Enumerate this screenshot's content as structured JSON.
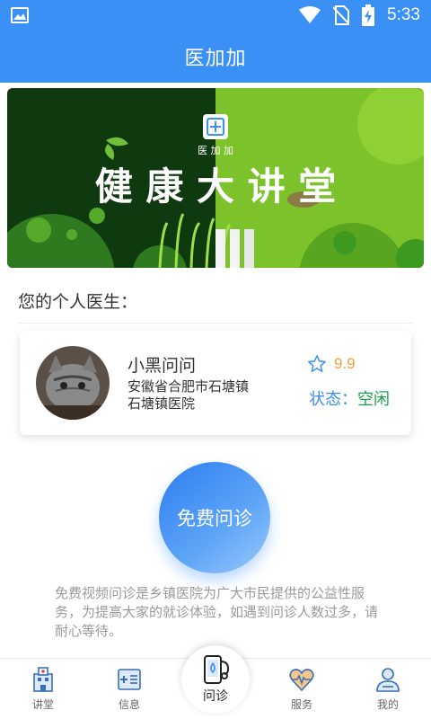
{
  "status_bar": {
    "time": "5:33",
    "icons": [
      "image-icon",
      "wifi-icon",
      "no-sim-icon",
      "battery-charging-icon"
    ]
  },
  "app_bar": {
    "title": "医加加"
  },
  "banner": {
    "brand": "医 加 加",
    "headline": "健 康 大 讲 堂"
  },
  "doctor_section": {
    "title": "您的个人医生：",
    "doctor": {
      "name": "小黑问问",
      "address": "安徽省合肥市石塘镇",
      "hospital": "石塘镇医院",
      "rating": "9.9",
      "status_label": "状态：",
      "status_value": "空闲"
    }
  },
  "consult": {
    "button_label": "免费问诊"
  },
  "notice": {
    "text": "免费视频问诊是乡镇医院为广大市民提供的公益性服务，为提高大家的就诊体验，如遇到问诊人数过多，请耐心等待。"
  },
  "tabs": [
    {
      "label": "讲堂",
      "icon": "hospital-icon"
    },
    {
      "label": "信息",
      "icon": "info-card-icon"
    },
    {
      "label": "问诊",
      "icon": "stethoscope-phone-icon"
    },
    {
      "label": "服务",
      "icon": "heart-pulse-icon"
    },
    {
      "label": "我的",
      "icon": "user-icon"
    }
  ],
  "colors": {
    "primary": "#3a90f5",
    "rating": "#f0a23b",
    "status_free": "#16a34a",
    "banner_dark": "#0f3a10",
    "banner_light": "#7cc22a"
  }
}
